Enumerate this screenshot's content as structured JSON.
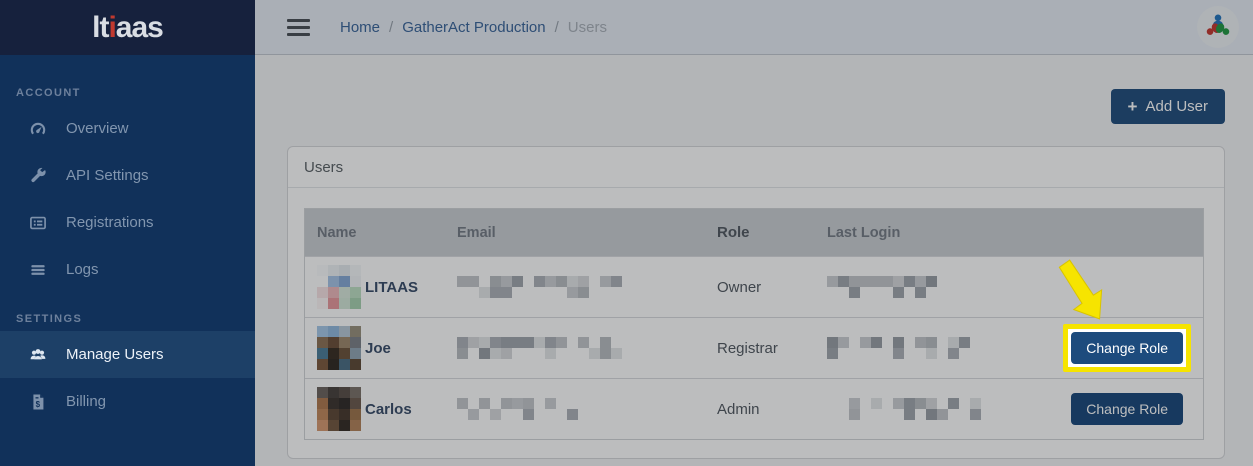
{
  "brand": {
    "lt": "lt",
    "i": "i",
    "aas": "aas"
  },
  "sidebar": {
    "sections": [
      {
        "label": "ACCOUNT",
        "items": [
          {
            "label": "Overview",
            "icon": "gauge-icon",
            "active": false
          },
          {
            "label": "API Settings",
            "icon": "wrench-icon",
            "active": false
          },
          {
            "label": "Registrations",
            "icon": "list-card-icon",
            "active": false
          },
          {
            "label": "Logs",
            "icon": "lines-icon",
            "active": false
          }
        ]
      },
      {
        "label": "SETTINGS",
        "items": [
          {
            "label": "Manage Users",
            "icon": "users-icon",
            "active": true
          },
          {
            "label": "Billing",
            "icon": "invoice-icon",
            "active": false
          }
        ]
      }
    ]
  },
  "topbar": {
    "separator": "/",
    "breadcrumb": [
      {
        "label": "Home",
        "type": "link"
      },
      {
        "label": "GatherAct Production",
        "type": "link"
      },
      {
        "label": "Users",
        "type": "current"
      }
    ],
    "avatar_icon": "gatheract-logo"
  },
  "main": {
    "add_user": {
      "icon": "+",
      "label": "Add User"
    },
    "card_title": "Users",
    "table": {
      "columns": [
        "Name",
        "Email",
        "Role",
        "Last Login"
      ],
      "rows": [
        {
          "name": "LITAAS",
          "role": "Owner",
          "email_redacted": true,
          "last_login_redacted": true,
          "action": null,
          "highlighted": false
        },
        {
          "name": "Joe",
          "role": "Registrar",
          "email_redacted": true,
          "last_login_redacted": true,
          "action": "Change Role",
          "highlighted": true
        },
        {
          "name": "Carlos",
          "role": "Admin",
          "email_redacted": true,
          "last_login_redacted": true,
          "action": "Change Role",
          "highlighted": false
        }
      ]
    }
  },
  "colors": {
    "sidebar_bg": "#11315a",
    "logo_band_bg": "#16213d",
    "brand_red": "#c0392f",
    "button_navy": "#1d4b7d",
    "highlight_yellow": "#f6e400",
    "active_item_bg": "#1d4067"
  }
}
